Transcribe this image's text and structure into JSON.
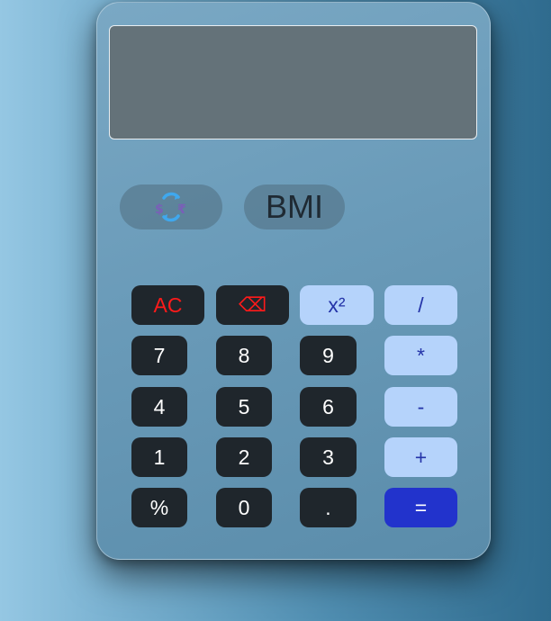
{
  "display": {
    "value": ""
  },
  "modes": {
    "convert_icon": "currency-convert-icon",
    "bmi_label": "BMI"
  },
  "keys": {
    "ac": "AC",
    "backspace_icon": "backspace-icon",
    "backspace_glyph": "⌫",
    "square": "x²",
    "divide": "/",
    "seven": "7",
    "eight": "8",
    "nine": "9",
    "multiply": "*",
    "four": "4",
    "five": "5",
    "six": "6",
    "minus": "-",
    "one": "1",
    "two": "2",
    "three": "3",
    "plus": "+",
    "percent": "%",
    "zero": "0",
    "dot": ".",
    "equals": "="
  },
  "colors": {
    "dark_key": "#1f262c",
    "light_key": "#b5d3fb",
    "equals_key": "#2233cc",
    "danger_text": "#ff1a1a",
    "display_bg": "#647279"
  }
}
